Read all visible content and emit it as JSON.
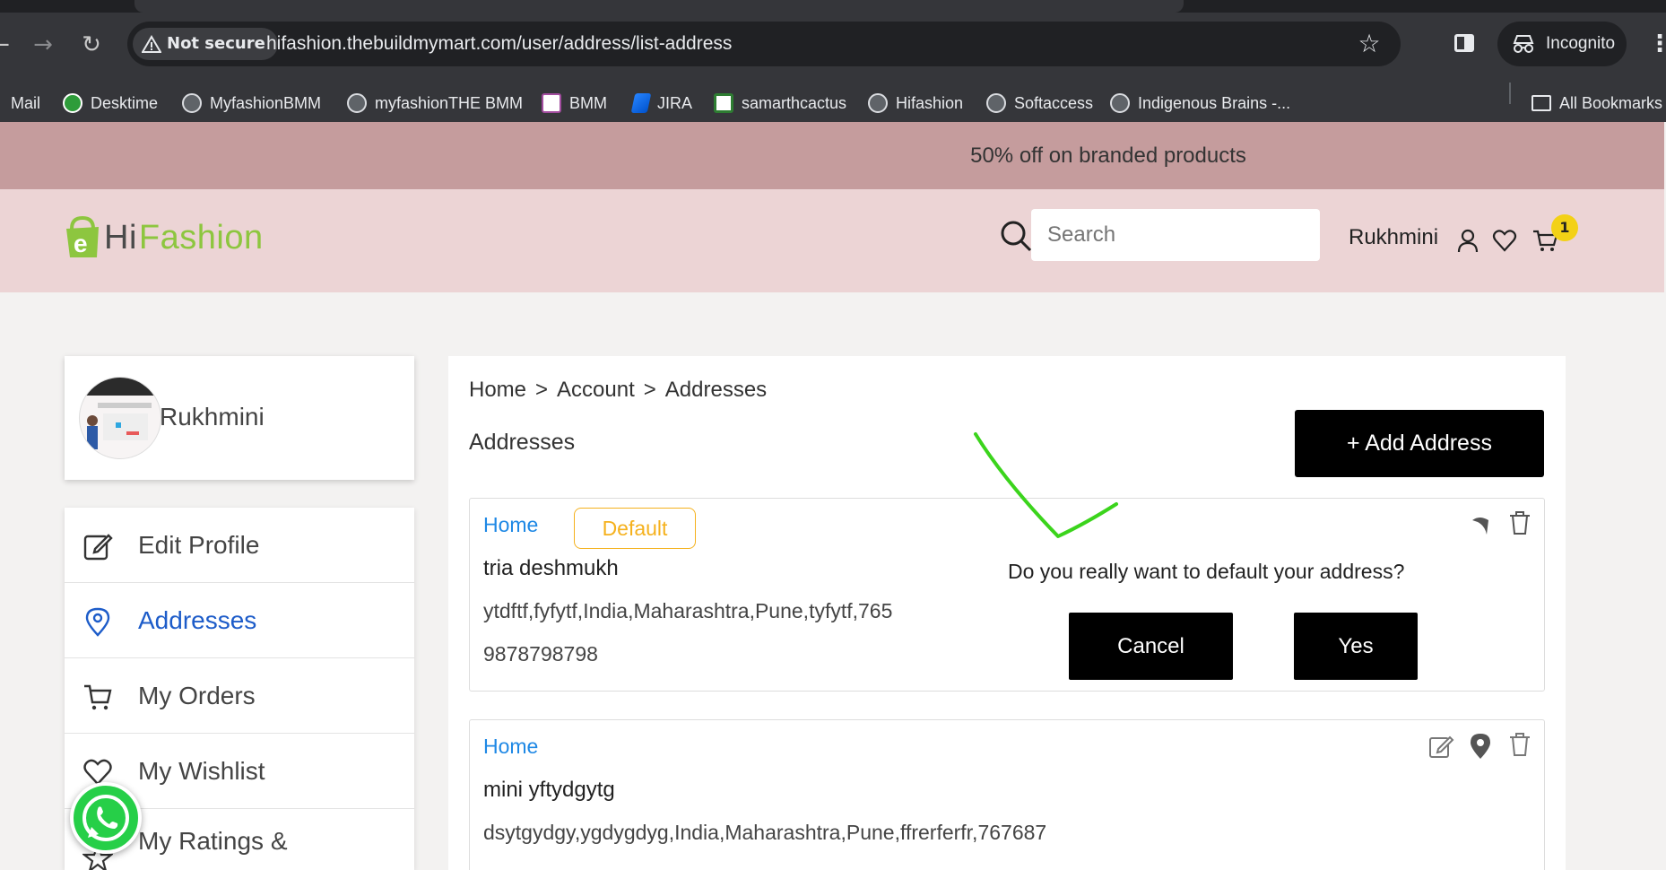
{
  "browser": {
    "security_label": "Not secure",
    "url": "hifashion.thebuildmymart.com/user/address/list-address",
    "incognito_label": "Incognito"
  },
  "bookmarks": [
    {
      "label": "Mail",
      "icon": "mail-icon"
    },
    {
      "label": "Desktime",
      "icon": "desktime-icon"
    },
    {
      "label": "MyfashionBMM",
      "icon": "globe-icon"
    },
    {
      "label": "myfashionTHE BMM",
      "icon": "globe-icon"
    },
    {
      "label": "BMM",
      "icon": "bmm-icon"
    },
    {
      "label": "JIRA",
      "icon": "jira-icon"
    },
    {
      "label": "samarthcactus",
      "icon": "cactus-icon"
    },
    {
      "label": "Hifashion",
      "icon": "globe-icon"
    },
    {
      "label": "Softaccess",
      "icon": "globe-icon"
    },
    {
      "label": "Indigenous Brains -...",
      "icon": "globe-icon"
    }
  ],
  "all_bookmarks_label": "All Bookmarks",
  "promo": {
    "text": "50% off on branded products"
  },
  "header": {
    "logo_hi": "Hi",
    "logo_fashion": "Fashion",
    "search_placeholder": "Search",
    "user_name": "Rukhmini",
    "cart_count": "1"
  },
  "profile": {
    "name": "Rukhmini"
  },
  "sidebar": {
    "items": [
      {
        "label": "Edit Profile",
        "icon": "edit-icon",
        "active": false
      },
      {
        "label": "Addresses",
        "icon": "location-pin-icon",
        "active": true
      },
      {
        "label": "My Orders",
        "icon": "cart-icon",
        "active": false
      },
      {
        "label": "My Wishlist",
        "icon": "heart-icon",
        "active": false
      },
      {
        "label": "My Ratings &",
        "icon": "star-icon",
        "active": false
      }
    ]
  },
  "main": {
    "breadcrumb": [
      "Home",
      "Account",
      "Addresses"
    ],
    "breadcrumb_sep": ">",
    "title": "Addresses",
    "add_button": "+ Add Address",
    "addresses": [
      {
        "type": "Home",
        "default_label": "Default",
        "name": "tria deshmukh",
        "address": "ytdftf,fyfytf,India,Maharashtra,Pune,tyfytf,765",
        "phone": "9878798798"
      },
      {
        "type": "Home",
        "name": "mini yftydgytg",
        "address": "dsytgydgy,ygdygdyg,India,Maharashtra,Pune,ffrerferfr,767687"
      }
    ],
    "confirm": {
      "question": "Do you really want to default your address?",
      "cancel": "Cancel",
      "yes": "Yes"
    }
  },
  "colors": {
    "promo_bg": "#c59c9d",
    "header_bg": "#ecd4d5",
    "accent_blue": "#1e88e5",
    "default_badge": "#f5b11d",
    "logo_green": "#8dc63f",
    "annotation_green": "#3bd41c"
  }
}
